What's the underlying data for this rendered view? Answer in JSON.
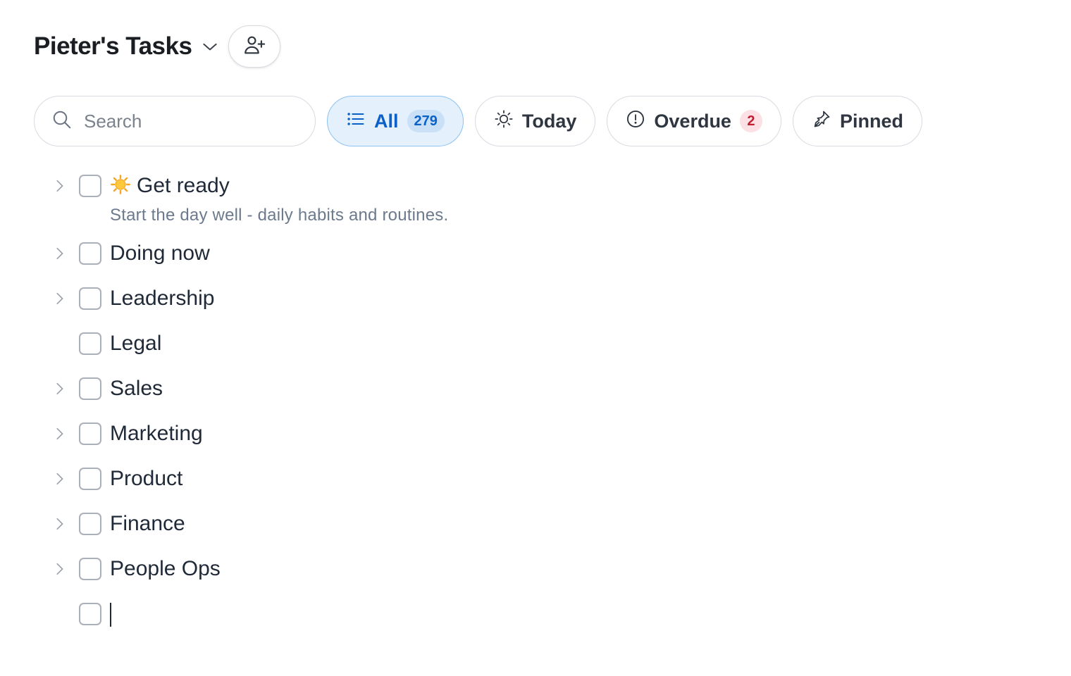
{
  "header": {
    "title": "Pieter's Tasks",
    "chevron_icon": "chevron-down-icon",
    "share_icon": "user-plus-icon"
  },
  "search": {
    "placeholder": "Search",
    "value": "",
    "icon": "search-icon"
  },
  "filters": [
    {
      "label": "All",
      "icon": "list-icon",
      "badge": "279",
      "active": true
    },
    {
      "label": "Today",
      "icon": "sun-icon",
      "badge": null,
      "active": false
    },
    {
      "label": "Overdue",
      "icon": "alert-circle-icon",
      "badge": "2",
      "active": false
    },
    {
      "label": "Pinned",
      "icon": "pin-icon",
      "badge": null,
      "active": false
    }
  ],
  "tasks": [
    {
      "title": "Get ready",
      "emoji": "sun-emoji",
      "description": "Start the day well - daily habits and routines.",
      "has_children": true,
      "checked": false
    },
    {
      "title": "Doing now",
      "has_children": true,
      "checked": false
    },
    {
      "title": "Leadership",
      "has_children": true,
      "checked": false
    },
    {
      "title": "Legal",
      "has_children": false,
      "checked": false
    },
    {
      "title": "Sales",
      "has_children": true,
      "checked": false
    },
    {
      "title": "Marketing",
      "has_children": true,
      "checked": false
    },
    {
      "title": "Product",
      "has_children": true,
      "checked": false
    },
    {
      "title": "Finance",
      "has_children": true,
      "checked": false
    },
    {
      "title": "People Ops",
      "has_children": true,
      "checked": false
    }
  ],
  "new_task": {
    "value": "",
    "checked": false
  },
  "colors": {
    "accent": "#0a62c9",
    "accent_bg": "#e4f1fd",
    "overdue": "#c01f33",
    "overdue_bg": "#fde0e4",
    "description": "#6c7a8d"
  }
}
